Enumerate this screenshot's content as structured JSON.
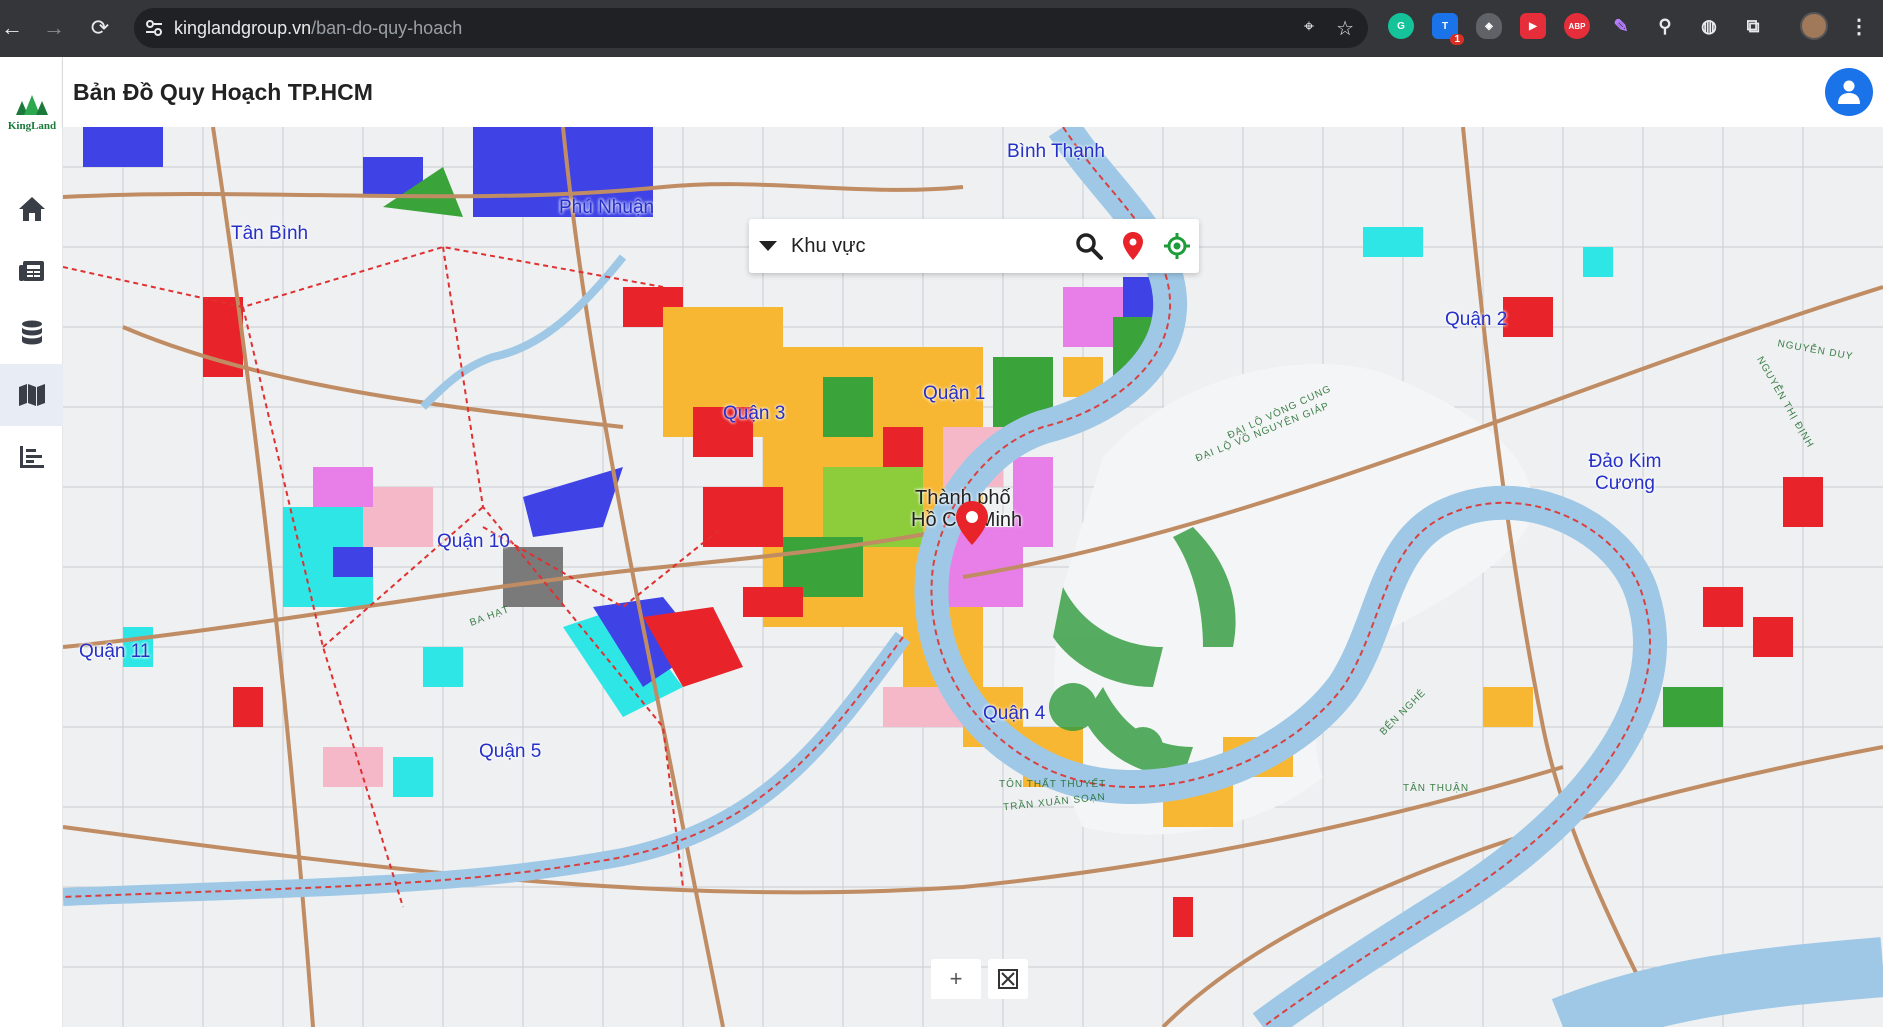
{
  "browser": {
    "url_host": "kinglandgroup.vn",
    "url_path": "/ban-do-quy-hoach",
    "badge_count": "1",
    "abp_label": "ABP"
  },
  "app": {
    "logo_text": "KingLand",
    "title": "Bản Đồ Quy Hoạch TP.HCM",
    "nav": [
      {
        "icon": "home-icon"
      },
      {
        "icon": "news-icon"
      },
      {
        "icon": "database-icon"
      },
      {
        "icon": "map-icon",
        "active": true
      },
      {
        "icon": "chart-icon"
      }
    ]
  },
  "search": {
    "dropdown_label": "Khu vực"
  },
  "map": {
    "districts": [
      "Bình Thạnh",
      "Phú Nhuận",
      "Tân Bình",
      "Quận 2",
      "Quận 1",
      "Quận 3",
      "Đảo Kim Cương",
      "Quận 10",
      "Quận 11",
      "Quận 4",
      "Quận 5"
    ],
    "city_label_line1": "Thành phố",
    "city_label_line2": "Hồ Chí Minh",
    "streets": [
      "ĐẠI LỘ VÕ NGUYÊN GIÁP",
      "TÔN THẤT THUYẾT",
      "TÂN THUẬN",
      "NGUYỄN DUY",
      "NGUYỄN THỊ ĐỊNH",
      "ĐẠI LỘ VÒNG CUNG",
      "BẾN NGHÉ",
      "BA HẠT",
      "TRẦN XUÂN SOẠN"
    ]
  },
  "colors": {
    "river": "#9fc8e6",
    "residential": "#f7b733",
    "commercial": "#e8232a",
    "public": "#3f43e6",
    "green": "#3aa33a",
    "water_service": "#2ee6e6",
    "accent": "#1a73e8"
  }
}
